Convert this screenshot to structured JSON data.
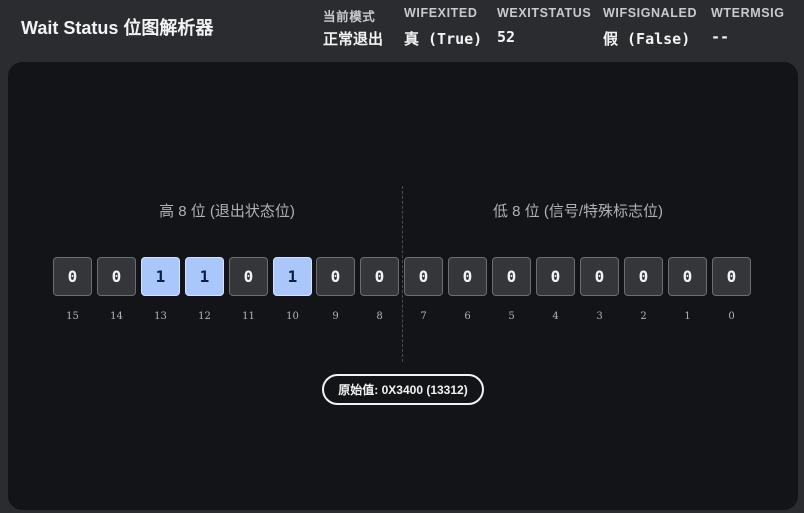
{
  "app": {
    "title": "Wait Status 位图解析器"
  },
  "status": [
    {
      "label": "当前模式",
      "value": "正常退出"
    },
    {
      "label": "WIFEXITED",
      "value": "真 (True)"
    },
    {
      "label": "WEXITSTATUS",
      "value": "52"
    },
    {
      "label": "WIFSIGNALED",
      "value": "假 (False)"
    },
    {
      "label": "WTERMSIG",
      "value": "--"
    }
  ],
  "groups": {
    "high": "高 8 位 (退出状态位)",
    "low": "低 8 位 (信号/特殊标志位)"
  },
  "bits": [
    {
      "index": "15",
      "value": "0",
      "on": false
    },
    {
      "index": "14",
      "value": "0",
      "on": false
    },
    {
      "index": "13",
      "value": "1",
      "on": true
    },
    {
      "index": "12",
      "value": "1",
      "on": true
    },
    {
      "index": "11",
      "value": "0",
      "on": false
    },
    {
      "index": "10",
      "value": "1",
      "on": true
    },
    {
      "index": "9",
      "value": "0",
      "on": false
    },
    {
      "index": "8",
      "value": "0",
      "on": false
    },
    {
      "index": "7",
      "value": "0",
      "on": false
    },
    {
      "index": "6",
      "value": "0",
      "on": false
    },
    {
      "index": "5",
      "value": "0",
      "on": false
    },
    {
      "index": "4",
      "value": "0",
      "on": false
    },
    {
      "index": "3",
      "value": "0",
      "on": false
    },
    {
      "index": "2",
      "value": "0",
      "on": false
    },
    {
      "index": "1",
      "value": "0",
      "on": false
    },
    {
      "index": "0",
      "value": "0",
      "on": false
    }
  ],
  "raw_value": {
    "text": "原始值: 0X3400 (13312)"
  },
  "colors": {
    "bit_on": "#a9c7fa",
    "bit_off": "#34363a",
    "panel": "#131417",
    "header": "#2b2c2f"
  }
}
